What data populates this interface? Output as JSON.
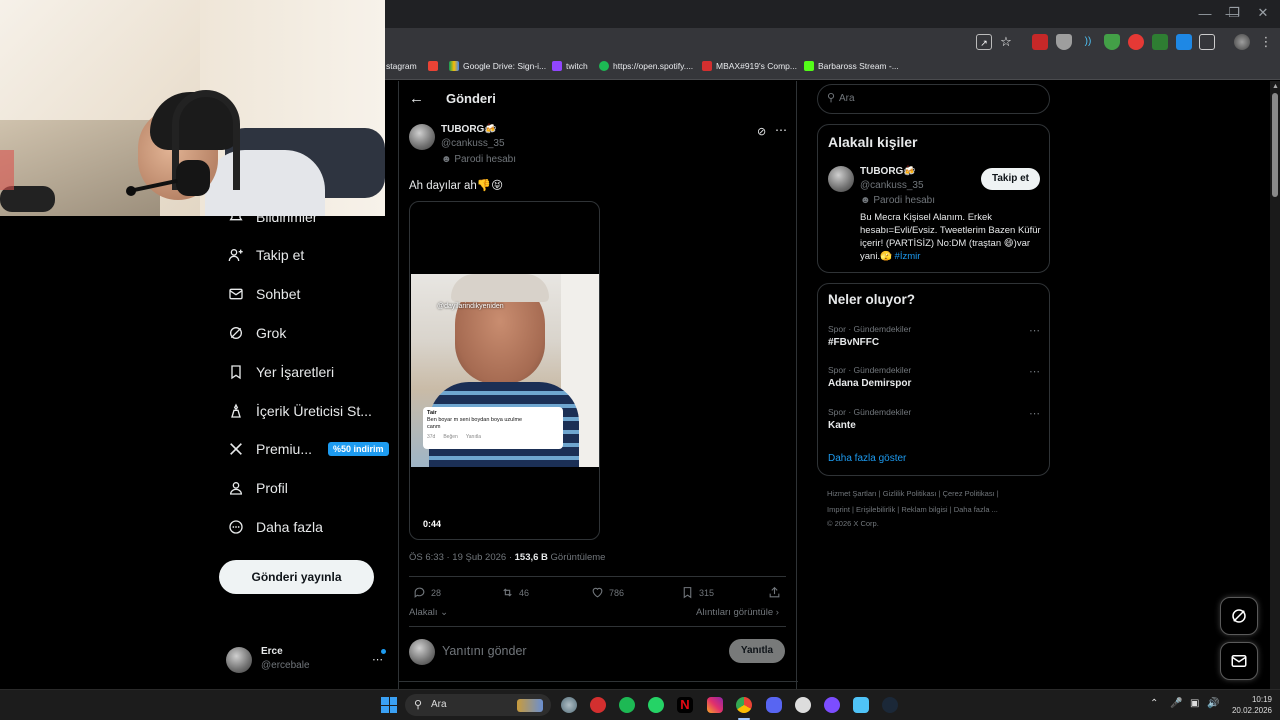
{
  "browser": {
    "bookmarks": [
      {
        "label": "stagram",
        "color": "#c13584"
      },
      {
        "label": "",
        "color": "#ea4335"
      },
      {
        "label": "Google Drive: Sign-i...",
        "color": "#fbbc04"
      },
      {
        "label": "twitch",
        "color": "#9146ff"
      },
      {
        "label": "https://open.spotify....",
        "color": "#1db954"
      },
      {
        "label": "MBAX#919's Comp...",
        "color": "#d32f2f"
      },
      {
        "label": "Barbaross Stream -...",
        "color": "#53fc18"
      }
    ]
  },
  "nav": {
    "items": [
      {
        "label": "Bildirimler",
        "icon": "bell-icon"
      },
      {
        "label": "Takip et",
        "icon": "add-person-icon"
      },
      {
        "label": "Sohbet",
        "icon": "mail-icon"
      },
      {
        "label": "Grok",
        "icon": "grok-icon"
      },
      {
        "label": "Yer İşaretleri",
        "icon": "bookmark-icon"
      },
      {
        "label": "İçerik Üreticisi St...",
        "icon": "creator-icon"
      },
      {
        "label": "Premiu...",
        "icon": "x-logo-icon"
      },
      {
        "label": "Profil",
        "icon": "person-icon"
      },
      {
        "label": "Daha fazla",
        "icon": "more-circle-icon"
      }
    ],
    "premium_badge": "%50 indirim",
    "post_button": "Gönderi yayınla",
    "account": {
      "name": "Erce",
      "handle": "@ercebale"
    }
  },
  "post": {
    "header_title": "Gönderi",
    "author": {
      "name": "TUBORG🍻",
      "handle": "@cankuss_35",
      "label": "Parodi hesabı"
    },
    "text": "Ah dayılar ah👎😝",
    "video": {
      "duration": "0:44",
      "overlay_caption": "@dayilarindikyeniden",
      "comment_name": "Tair",
      "comment_text": "Ben boyar m seni boydan boya uzulme canm",
      "comment_meta": [
        "37d",
        "Beğen",
        "Yanıtla"
      ]
    },
    "timestamp": "ÖS 6:33 · 19 Şub 2026 · ",
    "views_count": "153,6 B",
    "views_label": " Görüntüleme",
    "stats": {
      "replies": "28",
      "reposts": "46",
      "likes": "786",
      "bookmarks": "315"
    },
    "relevance": "Alakalı",
    "quotes_link": "Alıntıları görüntüle",
    "reply_placeholder": "Yanıtını gönder",
    "reply_button": "Yanıtla"
  },
  "sidebar": {
    "search_placeholder": "Ara",
    "related": {
      "title": "Alakalı kişiler",
      "name": "TUBORG🍻",
      "handle": "@cankuss_35",
      "label": "Parodi hesabı",
      "follow": "Takip et",
      "bio": "Bu Mecra Kişisel Alanım. Erkek hesabı=Evli/Evsiz. Tweetlerim Bazen Küfür içerir! (PARTİSİZ) No:DM (traştan 😄)var yani.🫣 ",
      "bio_tag": "#İzmir"
    },
    "trends": {
      "title": "Neler oluyor?",
      "items": [
        {
          "meta": "Spor · Gündemdekiler",
          "name": "#FBvNFFC"
        },
        {
          "meta": "Spor · Gündemdekiler",
          "name": "Adana Demirspor"
        },
        {
          "meta": "Spor · Gündemdekiler",
          "name": "Kante"
        }
      ],
      "show_more": "Daha fazla göster"
    },
    "footer": {
      "line1": "Hizmet Şartları  |  Gizlilik Politikası  |  Çerez Politikası  |",
      "line2": "Imprint  |  Erişilebilirlik  |  Reklam bilgisi  |  Daha fazla ...",
      "line3": "© 2026 X Corp."
    }
  },
  "taskbar": {
    "search_placeholder": "Ara",
    "time": "10:19",
    "date": "20.02.2026"
  },
  "colors": {
    "accent": "#1d9bf0",
    "background": "#000000",
    "border": "#2f3336",
    "muted": "#71767b"
  }
}
